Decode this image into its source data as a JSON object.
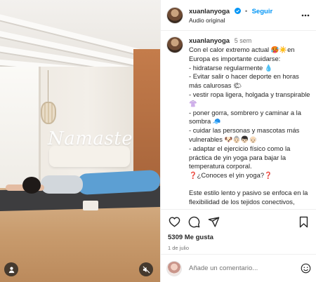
{
  "post": {
    "username": "xuanlanyoga",
    "separator": "•",
    "follow_label": "Seguir",
    "audio": "Audio original",
    "watermark": "Namaste"
  },
  "caption": {
    "username": "xuanlanyoga",
    "time": "5 sem",
    "lines": [
      "Con el calor extremo actual 🥵☀️en Europa es importante cuidarse:",
      "- hidratarse regularmente 💧",
      "- Evitar salir o hacer deporte en horas más calurosas 🌤",
      "- vestir ropa ligera, holgada y transpirable 👚",
      "- poner gorra, sombrero y caminar a la sombra 🧢",
      "- cuidar las personas y mascotas más vulnerables 🐶👵🏻👦🏻👴🏻",
      "- adaptar el ejercicio físico como la práctica de yin yoga para bajar la temperatura corporal.",
      "❓¿Conoces el yin yoga?❓",
      "",
      "Este estilo lento y pasivo se enfoca en la flexibilidad de los tejidos conectivos, como ligamentos, tendones y fascia, mediante posturas mantenidas durante"
    ]
  },
  "stats": {
    "likes": "5309 Me gusta",
    "date": "1 de julio"
  },
  "comment": {
    "placeholder": "Añade un comentario..."
  },
  "icons": {
    "verified": "verified-badge-icon",
    "more": "more-options-icon",
    "like": "heart-icon",
    "comment": "comment-icon",
    "share": "share-icon",
    "save": "bookmark-icon",
    "emoji": "emoji-icon",
    "user": "user-tag-icon",
    "mute": "muted-speaker-icon"
  },
  "colors": {
    "accent": "#0095f6",
    "text": "#262626",
    "muted": "#737373",
    "border": "#efefef"
  }
}
